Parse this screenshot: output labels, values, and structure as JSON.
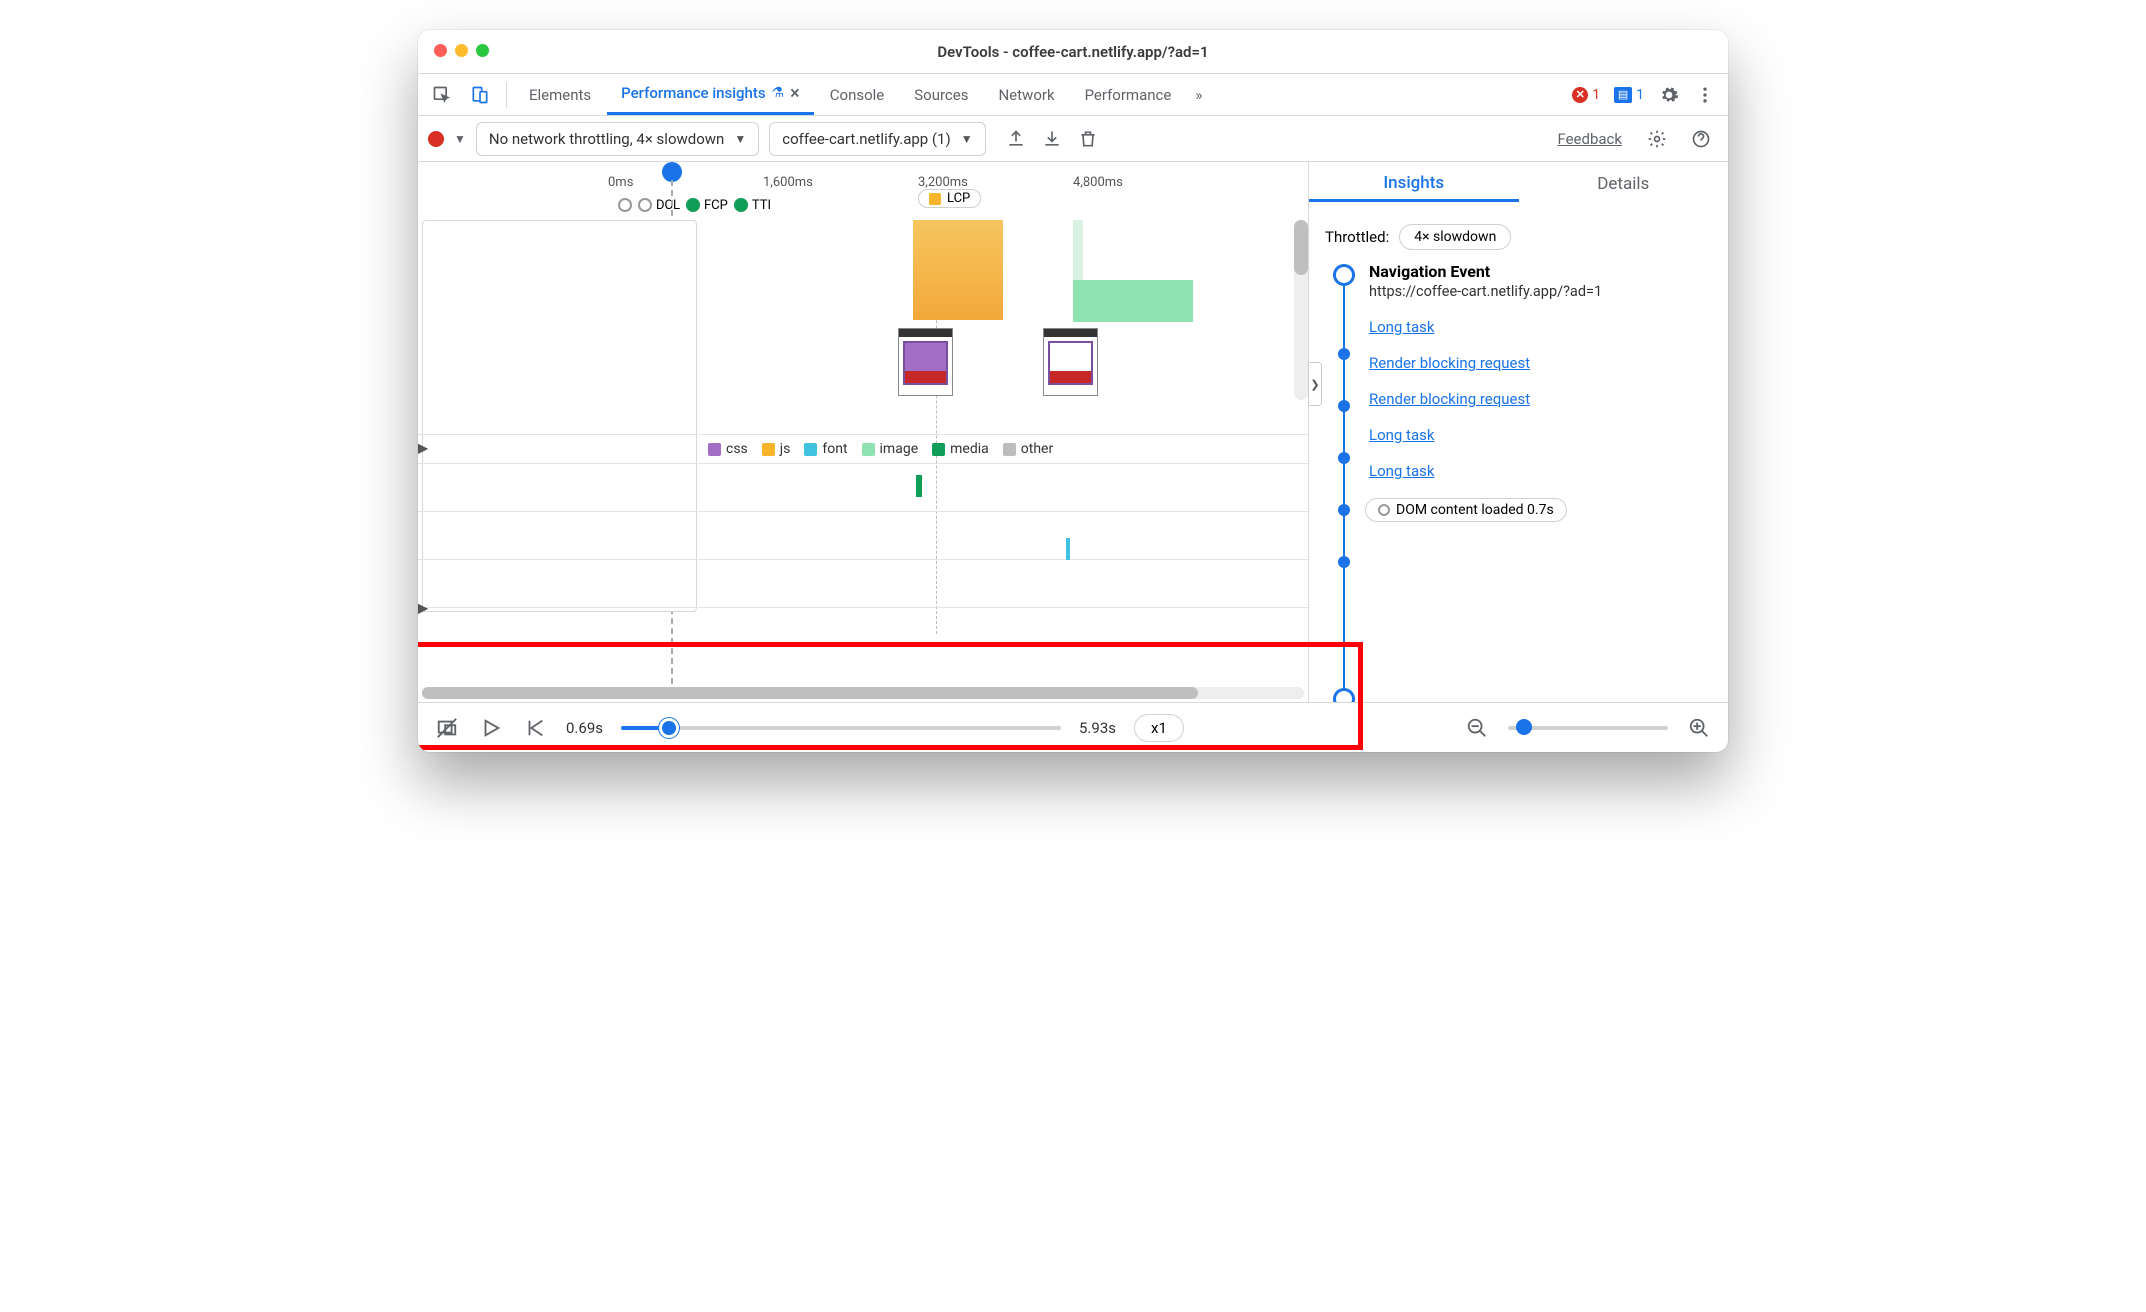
{
  "window": {
    "title": "DevTools - coffee-cart.netlify.app/?ad=1"
  },
  "tabs": {
    "elements": "Elements",
    "perf_insights": "Performance insights",
    "console": "Console",
    "sources": "Sources",
    "network": "Network",
    "performance": "Performance",
    "more": "»",
    "close_x": "×",
    "errors": "1",
    "messages": "1"
  },
  "toolbar": {
    "throttle_select": "No network throttling, 4× slowdown",
    "recording_select": "coffee-cart.netlify.app (1)",
    "feedback": "Feedback"
  },
  "timeline": {
    "ticks": [
      "0ms",
      "1,600ms",
      "3,200ms",
      "4,800ms"
    ],
    "markers": {
      "dcl": "DCL",
      "fcp": "FCP",
      "tti": "TTI",
      "lcp": "LCP"
    },
    "legend": {
      "css": "css",
      "js": "js",
      "font": "font",
      "image": "image",
      "media": "media",
      "other": "other"
    }
  },
  "right": {
    "tab_insights": "Insights",
    "tab_details": "Details",
    "throttled_label": "Throttled:",
    "throttled_value": "4× slowdown",
    "nav_title": "Navigation Event",
    "nav_url": "https://coffee-cart.netlify.app/?ad=1",
    "items": [
      "Long task",
      "Render blocking request",
      "Render blocking request",
      "Long task",
      "Long task"
    ],
    "dcl_chip": "DOM content loaded 0.7s"
  },
  "bottom": {
    "time_start": "0.69s",
    "time_end": "5.93s",
    "speed": "x1"
  }
}
